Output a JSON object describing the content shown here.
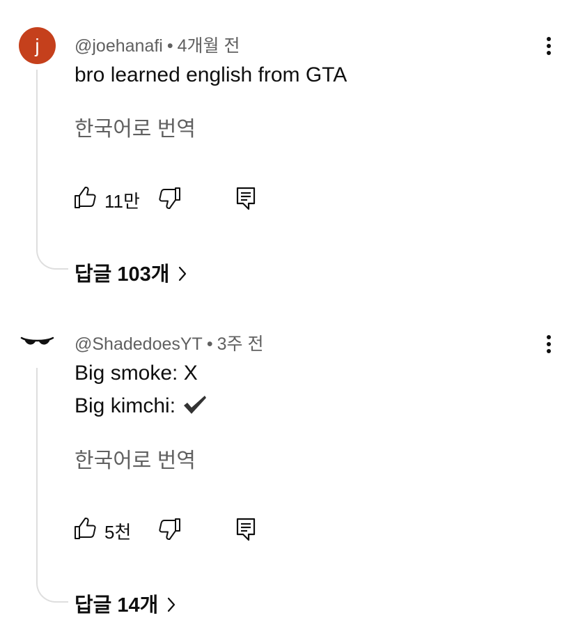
{
  "comments": [
    {
      "avatar_letter": "j",
      "avatar_color": "#c5401c",
      "handle": "@joehanafi",
      "separator": "•",
      "time": "4개월 전",
      "lines": [
        "bro learned english from GTA"
      ],
      "translate_label": "한국어로 번역",
      "like_count": "11만",
      "replies_label": "답글 103개"
    },
    {
      "avatar_icon": "sunglasses-icon",
      "handle": "@ShadedoesYT",
      "separator": "•",
      "time": "3주 전",
      "lines": [
        "Big smoke: X",
        "Big kimchi:"
      ],
      "line_icon": "checkmark-icon",
      "translate_label": "한국어로 번역",
      "like_count": "5천",
      "replies_label": "답글 14개"
    }
  ],
  "icons": {
    "like": "thumbs-up-icon",
    "dislike": "thumbs-down-icon",
    "reply": "reply-comment-icon",
    "more": "more-vertical-icon",
    "chevron": "chevron-right-icon"
  }
}
